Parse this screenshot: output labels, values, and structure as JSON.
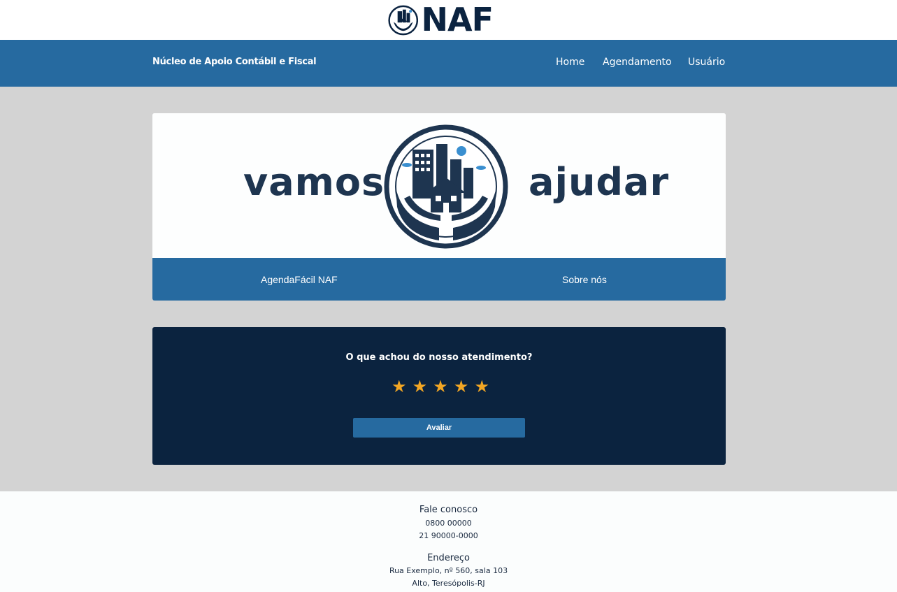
{
  "logo": {
    "text": "NAF"
  },
  "navbar": {
    "brand": "Núcleo de Apoio Contábil e Fiscal",
    "links": [
      "Home",
      "Agendamento",
      "Usuário"
    ]
  },
  "hero": {
    "word_left": "vamos",
    "word_right": "ajudar",
    "links": [
      "AgendaFácil NAF",
      "Sobre nós"
    ]
  },
  "rating": {
    "question": "O que achou do nosso atendimento?",
    "stars": [
      "★",
      "★",
      "★",
      "★",
      "★"
    ],
    "star_color": "#f2a624",
    "button_label": "Avaliar"
  },
  "footer": {
    "contact_title": "Fale conosco",
    "phones": [
      "0800 00000",
      "21 90000-0000"
    ],
    "address_title": "Endereço",
    "address_lines": [
      "Rua Exemplo, nº 560, sala 103",
      "Alto, Teresópolis-RJ"
    ]
  },
  "colors": {
    "primary_blue": "#266aa0",
    "navy": "#0b233f",
    "page_background": "#d3d3d3"
  }
}
